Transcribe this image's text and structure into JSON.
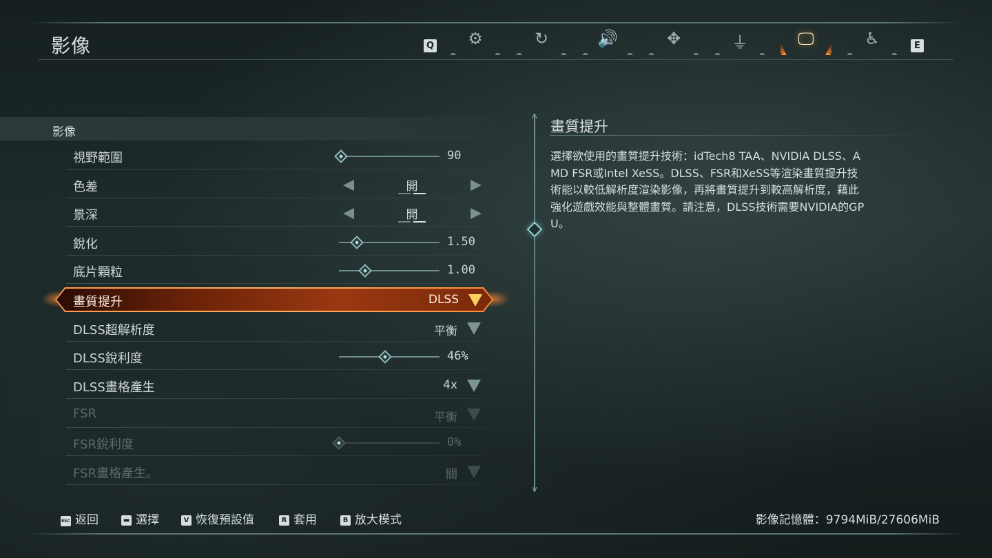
{
  "page": {
    "title": "影像"
  },
  "tabs": {
    "prev_key": "Q",
    "next_key": "E",
    "items": [
      {
        "icon": "gears-icon",
        "glyph": "⚙",
        "active": false
      },
      {
        "icon": "refresh-icon",
        "glyph": "↻",
        "active": false
      },
      {
        "icon": "speaker-icon",
        "glyph": "🔊",
        "active": false
      },
      {
        "icon": "move-icon",
        "glyph": "✥",
        "active": false
      },
      {
        "icon": "joystick-icon",
        "glyph": "⏚",
        "active": false
      },
      {
        "icon": "monitor-icon",
        "glyph": "🖵",
        "active": true
      },
      {
        "icon": "accessibility-icon",
        "glyph": "♿",
        "active": false
      }
    ]
  },
  "settings": {
    "section_title": "影像",
    "rows": [
      {
        "label": "視野範圍",
        "type": "slider",
        "value": "90",
        "fraction": 0.02,
        "disabled": false
      },
      {
        "label": "色差",
        "type": "toggle",
        "value": "開",
        "disabled": false
      },
      {
        "label": "景深",
        "type": "toggle",
        "value": "開",
        "disabled": false
      },
      {
        "label": "銳化",
        "type": "slider",
        "value": "1.50",
        "fraction": 0.18,
        "disabled": false
      },
      {
        "label": "底片顆粒",
        "type": "slider",
        "value": "1.00",
        "fraction": 0.26,
        "disabled": false
      },
      {
        "label": "畫質提升",
        "type": "dropdown",
        "value": "DLSS",
        "selected": true,
        "disabled": false
      },
      {
        "label": "DLSS超解析度",
        "type": "dropdown",
        "value": "平衡",
        "disabled": false
      },
      {
        "label": "DLSS銳利度",
        "type": "slider",
        "value": "46%",
        "fraction": 0.46,
        "disabled": false
      },
      {
        "label": "DLSS畫格產生",
        "type": "dropdown",
        "value": "4x",
        "disabled": false
      },
      {
        "label": "FSR",
        "type": "dropdown",
        "value": "平衡",
        "disabled": true
      },
      {
        "label": "FSR銳利度",
        "type": "slider",
        "value": "0%",
        "fraction": 0.0,
        "disabled": true
      },
      {
        "label": "FSR畫格產生。",
        "type": "dropdown",
        "value": "關",
        "disabled": true
      }
    ]
  },
  "description": {
    "title": "畫質提升",
    "text": "選擇欲使用的畫質提升技術：idTech8 TAA、NVIDIA DLSS、AMD FSR或Intel XeSS。DLSS、FSR和XeSS等渲染畫質提升技術能以較低解析度渲染影像，再將畫質提升到較高解析度，藉此強化遊戲效能與整體畫質。請注意，DLSS技術需要NVIDIA的GPU。"
  },
  "footer": {
    "hints": [
      {
        "key": "ESC",
        "label": "返回"
      },
      {
        "key": "▬",
        "label": "選擇"
      },
      {
        "key": "V",
        "label": "恢復預設值"
      },
      {
        "key": "R",
        "label": "套用"
      },
      {
        "key": "B",
        "label": "放大模式"
      }
    ],
    "vram": "影像記憶體：9794MiB/27606MiB"
  },
  "colors": {
    "accent": "#ff8a2a",
    "teal": "#8fbcbc"
  }
}
